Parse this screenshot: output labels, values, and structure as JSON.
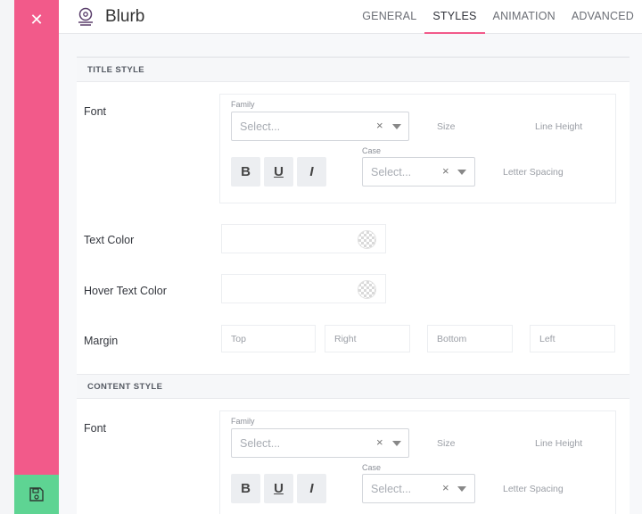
{
  "sidebar": {
    "close_icon": "close-icon",
    "save_icon": "save-icon",
    "accent": "#f25a8a",
    "save_color": "#5ed493"
  },
  "header": {
    "title": "Blurb",
    "tabs": [
      {
        "label": "GENERAL",
        "active": false
      },
      {
        "label": "STYLES",
        "active": true
      },
      {
        "label": "ANIMATION",
        "active": false
      },
      {
        "label": "ADVANCED",
        "active": false
      }
    ]
  },
  "title_style": {
    "heading": "TITLE STYLE",
    "font_label": "Font",
    "family_label": "Family",
    "family_placeholder": "Select...",
    "size_label": "Size",
    "line_height_label": "Line Height",
    "case_label": "Case",
    "case_placeholder": "Select...",
    "letter_spacing_label": "Letter Spacing",
    "bold": "B",
    "underline": "U",
    "italic": "I",
    "text_color_label": "Text Color",
    "hover_text_color_label": "Hover Text Color",
    "margin_label": "Margin",
    "margin_top": "Top",
    "margin_right": "Right",
    "margin_bottom": "Bottom",
    "margin_left": "Left"
  },
  "content_style": {
    "heading": "CONTENT STYLE",
    "font_label": "Font",
    "family_label": "Family",
    "family_placeholder": "Select...",
    "size_label": "Size",
    "line_height_label": "Line Height",
    "case_label": "Case",
    "case_placeholder": "Select...",
    "letter_spacing_label": "Letter Spacing",
    "bold": "B",
    "underline": "U",
    "italic": "I"
  }
}
